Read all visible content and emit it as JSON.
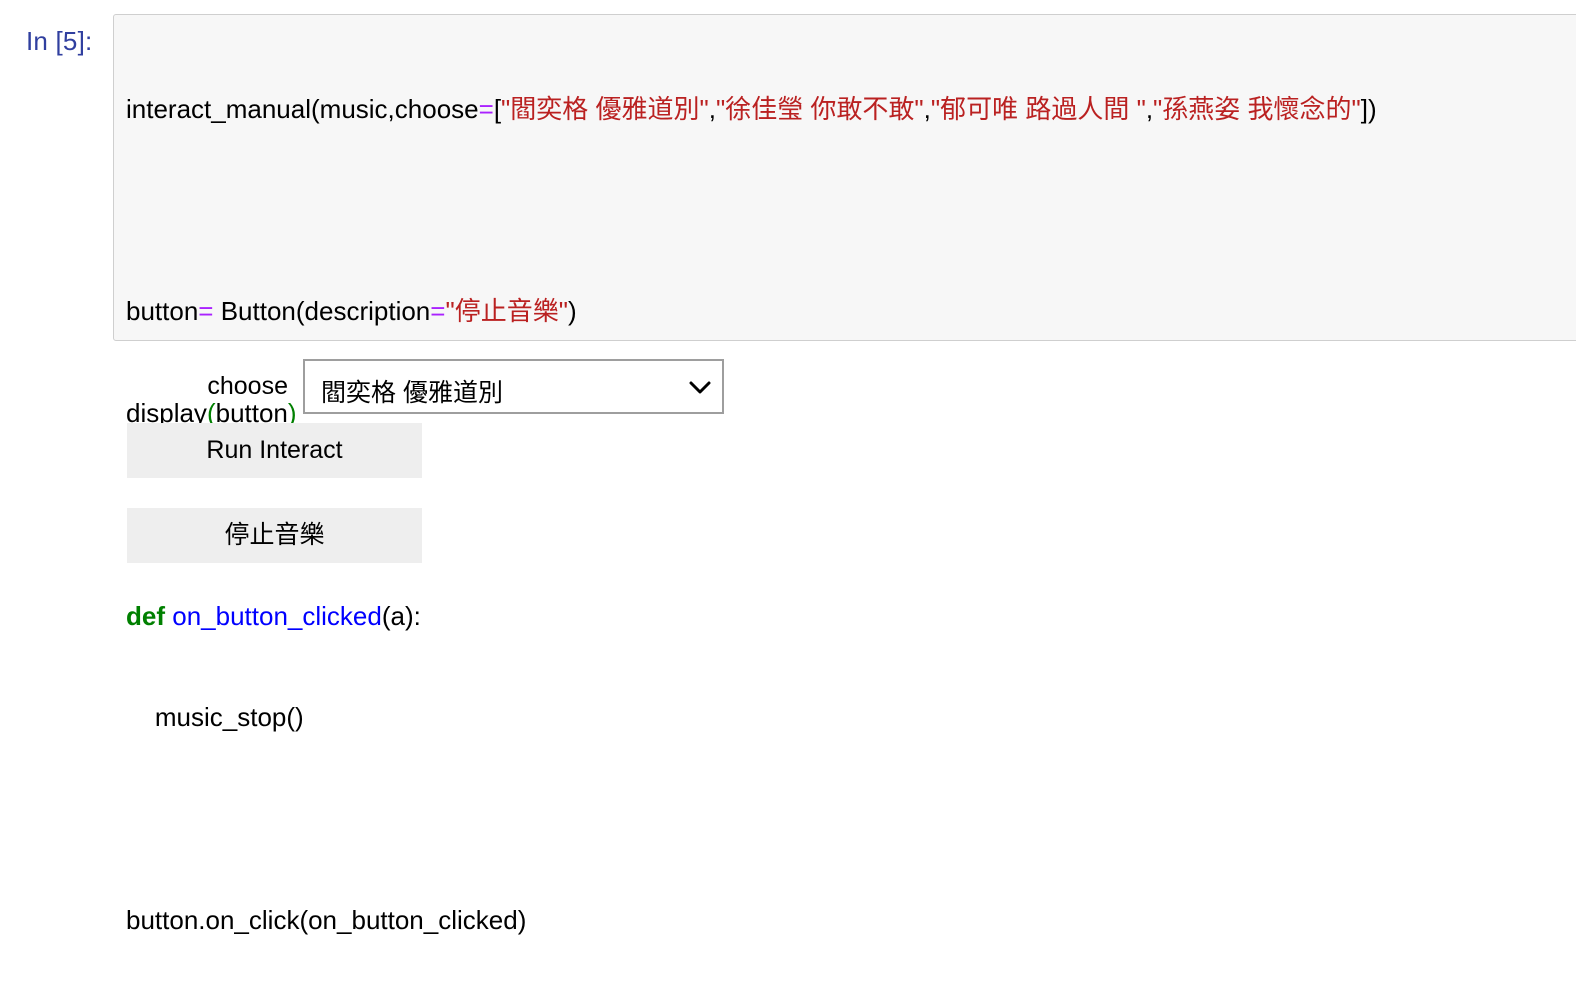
{
  "cell": {
    "prompt": "In [5]:",
    "code": {
      "line1": {
        "a": "interact_manual(music,choose",
        "eq": "=",
        "b": "[",
        "s1": "\"閻奕格 優雅道別\"",
        "c1": ",",
        "s2": "\"徐佳瑩 你敢不敢\"",
        "c2": ",",
        "s3": "\"郁可唯 路過人間 \"",
        "c3": ",",
        "s4": "\"孫燕姿 我懷念的\"",
        "end": "])"
      },
      "line3": {
        "a": "button",
        "eq": "=",
        "b": " Button(description",
        "eq2": "=",
        "s": "\"停止音樂\"",
        "end": ")"
      },
      "line4": {
        "a": "display",
        "p1": "(",
        "b": "button",
        "p2": ")"
      },
      "line6": {
        "kw": "def",
        "sp": " ",
        "fn": "on_button_clicked",
        "rest": "(a):"
      },
      "line7": "    music_stop()",
      "line9": "button.on_click(on_button_clicked)"
    }
  },
  "widgets": {
    "choose_label": "choose",
    "dropdown_value": "閻奕格 優雅道別",
    "run_button": "Run Interact",
    "stop_button": "停止音樂"
  }
}
